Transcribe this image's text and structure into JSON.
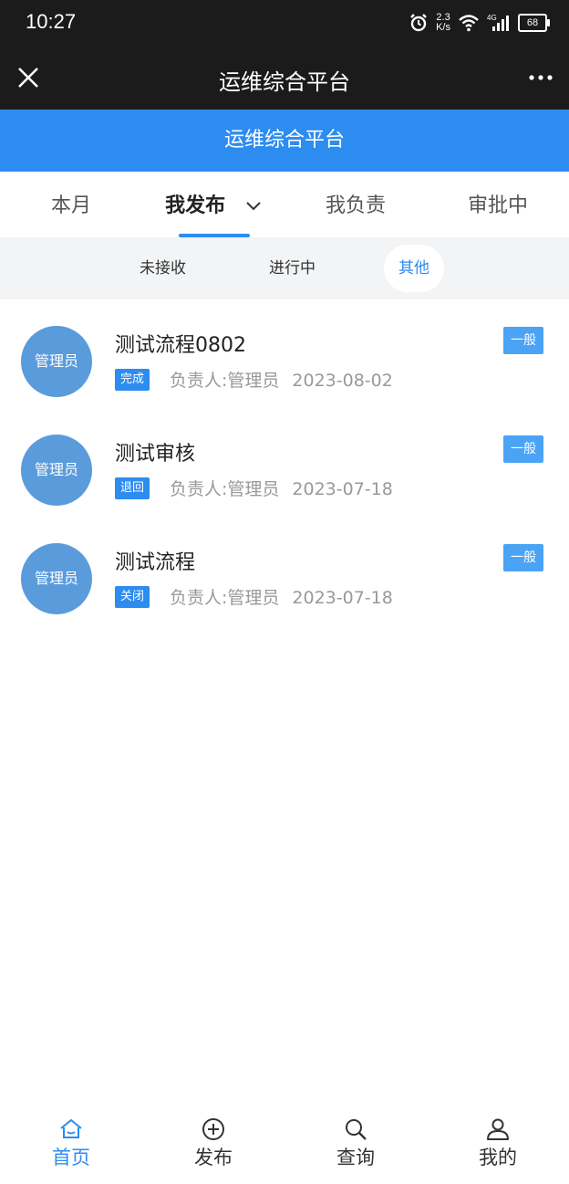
{
  "status_bar": {
    "time": "10:27",
    "net_speed_value": "2.3",
    "net_speed_unit": "K/s",
    "network": "4G",
    "battery": "68"
  },
  "title_bar": {
    "title": "运维综合平台"
  },
  "app_header": {
    "title": "运维综合平台"
  },
  "tabs": [
    {
      "label": "本月",
      "active": false
    },
    {
      "label": "我发布",
      "active": true
    },
    {
      "label": "我负责",
      "active": false
    },
    {
      "label": "审批中",
      "active": false
    }
  ],
  "sub_filters": [
    {
      "label": "未接收",
      "active": false
    },
    {
      "label": "进行中",
      "active": false
    },
    {
      "label": "其他",
      "active": true
    }
  ],
  "items": [
    {
      "avatar": "管理员",
      "title": "测试流程0802",
      "status": "完成",
      "owner": "负责人:管理员",
      "date": "2023-08-02",
      "level": "一般"
    },
    {
      "avatar": "管理员",
      "title": "测试审核",
      "status": "退回",
      "owner": "负责人:管理员",
      "date": "2023-07-18",
      "level": "一般"
    },
    {
      "avatar": "管理员",
      "title": "测试流程",
      "status": "关闭",
      "owner": "负责人:管理员",
      "date": "2023-07-18",
      "level": "一般"
    }
  ],
  "bottom_nav": [
    {
      "label": "首页",
      "icon": "home-icon",
      "active": true
    },
    {
      "label": "发布",
      "icon": "plus-circle-icon",
      "active": false
    },
    {
      "label": "查询",
      "icon": "search-icon",
      "active": false
    },
    {
      "label": "我的",
      "icon": "user-icon",
      "active": false
    }
  ],
  "colors": {
    "accent": "#2d8cf0",
    "avatar": "#5a9bdc",
    "level_badge": "#4aa3f5",
    "dark_bar": "#1b1b1b"
  }
}
